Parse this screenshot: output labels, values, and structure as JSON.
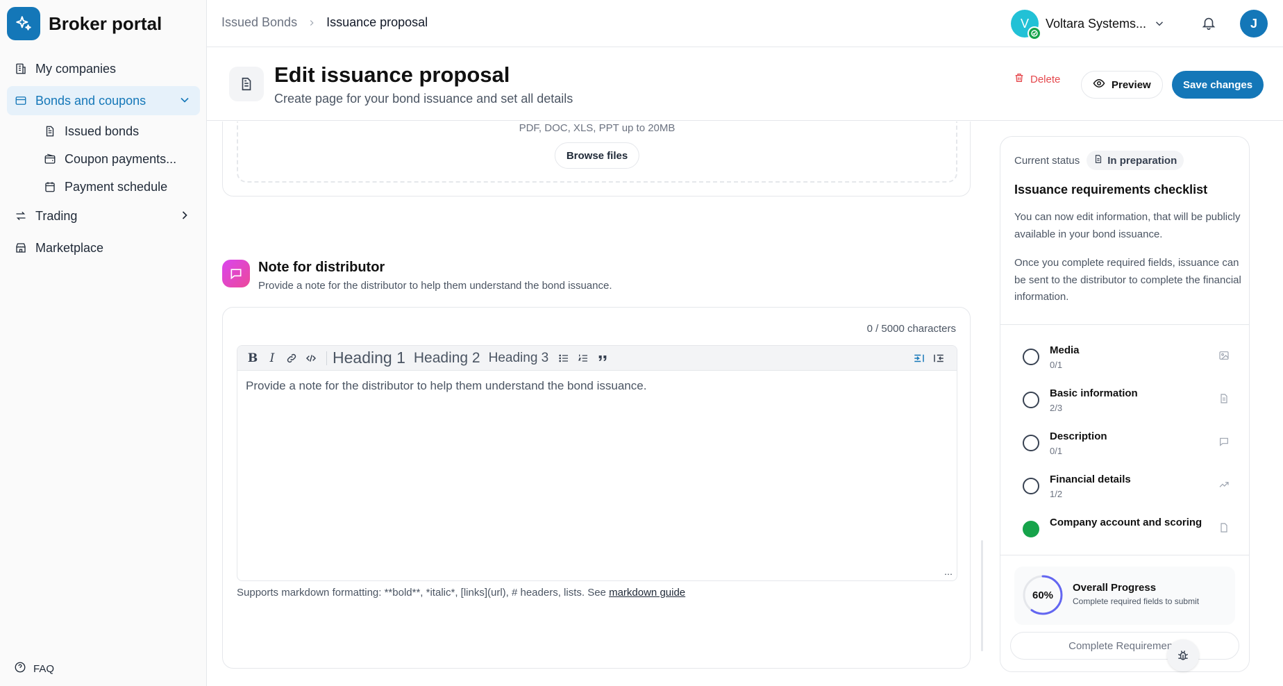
{
  "brand": {
    "name": "Broker portal",
    "color": "#1477b8"
  },
  "sidebar": {
    "items": [
      {
        "label": "My companies",
        "icon": "building-icon"
      },
      {
        "label": "Bonds and coupons",
        "icon": "card-icon",
        "active": true,
        "expanded": true
      },
      {
        "label": "Trading",
        "icon": "arrows-swap-icon"
      },
      {
        "label": "Marketplace",
        "icon": "store-icon"
      }
    ],
    "subitems": [
      {
        "label": "Issued bonds",
        "icon": "document-icon"
      },
      {
        "label": "Coupon payments...",
        "icon": "wallet-icon"
      },
      {
        "label": "Payment schedule",
        "icon": "calendar-icon"
      }
    ],
    "faq": "FAQ"
  },
  "topbar": {
    "breadcrumb": [
      "Issued Bonds",
      "Issuance proposal"
    ],
    "company": {
      "initial": "V",
      "name": "Voltara Systems..."
    },
    "user_initial": "J"
  },
  "header": {
    "title": "Edit issuance proposal",
    "subtitle": "Create page for your bond issuance and set all details",
    "delete_label": "Delete",
    "preview_label": "Preview",
    "save_label": "Save changes"
  },
  "upload": {
    "hint": "PDF, DOC, XLS, PPT up to 20MB",
    "browse_label": "Browse files"
  },
  "note": {
    "title": "Note for distributor",
    "subtitle": "Provide a note for the distributor to help them understand the bond issuance.",
    "char_count": "0 / 5000 characters",
    "placeholder": "Provide a note for the distributor to help them understand the bond issuance.",
    "toolbar": {
      "bold": "B",
      "italic": "I",
      "h1": "Heading 1",
      "h2": "Heading 2",
      "h3": "Heading 3"
    },
    "md_hint": "Supports markdown formatting: **bold**, *italic*, [links](url), # headers, lists. See ",
    "md_link": "markdown guide"
  },
  "panel": {
    "status_label": "Current status",
    "status_value": "In preparation",
    "title": "Issuance requirements checklist",
    "desc1": "You can now edit information, that will be publicly available in your bond issuance.",
    "desc2": "Once you complete required fields, issuance can be sent to the distributor to complete the financial information.",
    "checklist": [
      {
        "label": "Media",
        "count": "0/1",
        "icon": "image-icon",
        "done": false
      },
      {
        "label": "Basic information",
        "count": "2/3",
        "icon": "document-icon",
        "done": false
      },
      {
        "label": "Description",
        "count": "0/1",
        "icon": "chat-icon",
        "done": false
      },
      {
        "label": "Financial details",
        "count": "1/2",
        "icon": "trend-up-icon",
        "done": false
      },
      {
        "label": "Company account and scoring",
        "count": "",
        "icon": "document-icon",
        "done": true
      }
    ],
    "progress": {
      "percent_label": "60%",
      "value": 0.6,
      "title": "Overall Progress",
      "subtitle": "Complete required fields to submit"
    },
    "complete_label": "Complete Requirements"
  },
  "colors": {
    "accent": "#1477b8",
    "danger": "#e5484d",
    "success": "#16a34a",
    "section_icon": "#d946ef",
    "progress_ring": "#6366f1"
  }
}
